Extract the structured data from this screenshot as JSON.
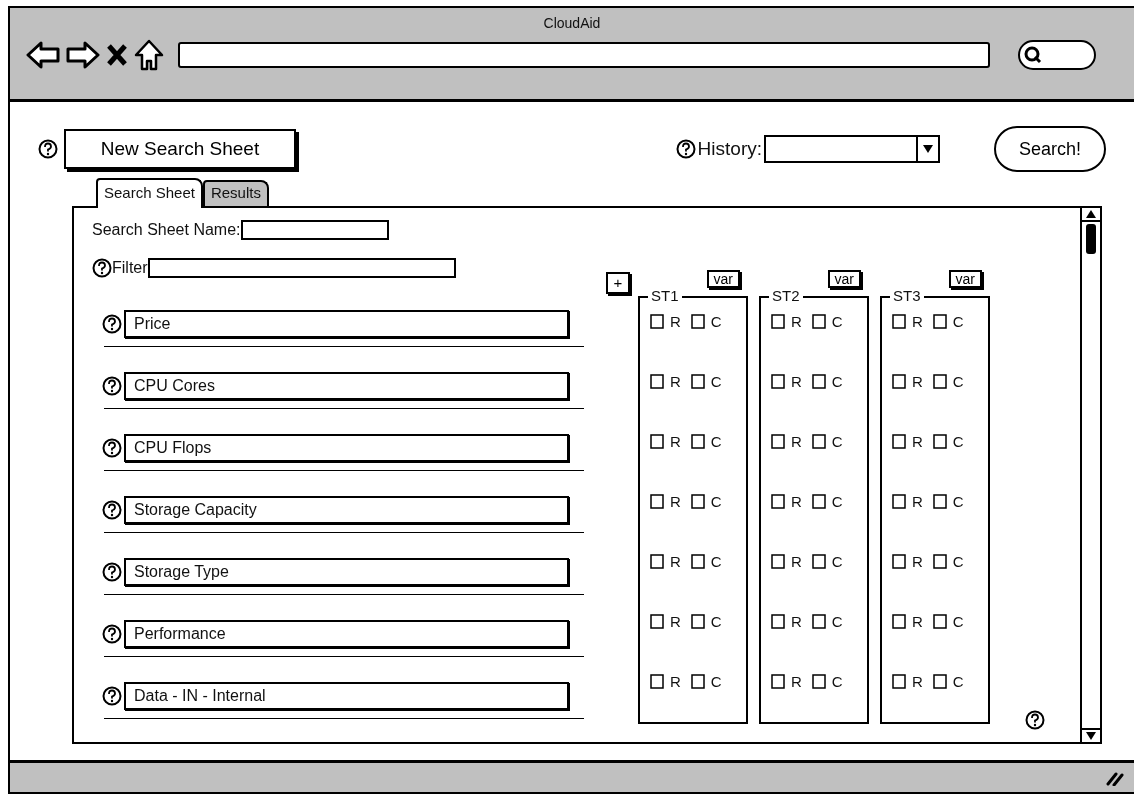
{
  "window": {
    "title": "CloudAid"
  },
  "header": {
    "new_sheet_button": "New Search Sheet",
    "history_label": "History:",
    "search_button": "Search!"
  },
  "tabs": [
    {
      "label": "Search Sheet",
      "selected": true
    },
    {
      "label": "Results",
      "selected": false
    }
  ],
  "sheet_name_label": "Search Sheet Name:",
  "filter_label": "Filter",
  "attributes": [
    {
      "value": "Price"
    },
    {
      "value": "CPU Cores"
    },
    {
      "value": "CPU Flops"
    },
    {
      "value": "Storage Capacity"
    },
    {
      "value": "Storage Type"
    },
    {
      "value": "Performance"
    },
    {
      "value": "Data - IN - Internal"
    }
  ],
  "add_button": "+",
  "setups": [
    {
      "title": "ST1",
      "var_button": "var",
      "rows": [
        {
          "options": [
            {
              "label": "R",
              "checked": false
            },
            {
              "label": "C",
              "checked": false
            }
          ]
        },
        {
          "options": [
            {
              "label": "R",
              "checked": false
            },
            {
              "label": "C",
              "checked": false
            }
          ]
        },
        {
          "options": [
            {
              "label": "R",
              "checked": false
            },
            {
              "label": "C",
              "checked": false
            }
          ]
        },
        {
          "options": [
            {
              "label": "R",
              "checked": false
            },
            {
              "label": "C",
              "checked": false
            }
          ]
        },
        {
          "options": [
            {
              "label": "R",
              "checked": false
            },
            {
              "label": "C",
              "checked": false
            }
          ]
        },
        {
          "options": [
            {
              "label": "R",
              "checked": false
            },
            {
              "label": "C",
              "checked": false
            }
          ]
        },
        {
          "options": [
            {
              "label": "R",
              "checked": false
            },
            {
              "label": "C",
              "checked": false
            }
          ]
        }
      ]
    },
    {
      "title": "ST2",
      "var_button": "var",
      "rows": [
        {
          "options": [
            {
              "label": "R",
              "checked": false
            },
            {
              "label": "C",
              "checked": false
            }
          ]
        },
        {
          "options": [
            {
              "label": "R",
              "checked": false
            },
            {
              "label": "C",
              "checked": false
            }
          ]
        },
        {
          "options": [
            {
              "label": "R",
              "checked": false
            },
            {
              "label": "C",
              "checked": false
            }
          ]
        },
        {
          "options": [
            {
              "label": "R",
              "checked": false
            },
            {
              "label": "C",
              "checked": false
            }
          ]
        },
        {
          "options": [
            {
              "label": "R",
              "checked": false
            },
            {
              "label": "C",
              "checked": false
            }
          ]
        },
        {
          "options": [
            {
              "label": "R",
              "checked": false
            },
            {
              "label": "C",
              "checked": false
            }
          ]
        },
        {
          "options": [
            {
              "label": "R",
              "checked": false
            },
            {
              "label": "C",
              "checked": false
            }
          ]
        }
      ]
    },
    {
      "title": "ST3",
      "var_button": "var",
      "rows": [
        {
          "options": [
            {
              "label": "R",
              "checked": false
            },
            {
              "label": "C",
              "checked": false
            }
          ]
        },
        {
          "options": [
            {
              "label": "R",
              "checked": false
            },
            {
              "label": "C",
              "checked": false
            }
          ]
        },
        {
          "options": [
            {
              "label": "R",
              "checked": false
            },
            {
              "label": "C",
              "checked": false
            }
          ]
        },
        {
          "options": [
            {
              "label": "R",
              "checked": false
            },
            {
              "label": "C",
              "checked": false
            }
          ]
        },
        {
          "options": [
            {
              "label": "R",
              "checked": false
            },
            {
              "label": "C",
              "checked": false
            }
          ]
        },
        {
          "options": [
            {
              "label": "R",
              "checked": false
            },
            {
              "label": "C",
              "checked": false
            }
          ]
        },
        {
          "options": [
            {
              "label": "R",
              "checked": false
            },
            {
              "label": "C",
              "checked": false
            }
          ]
        }
      ]
    }
  ]
}
